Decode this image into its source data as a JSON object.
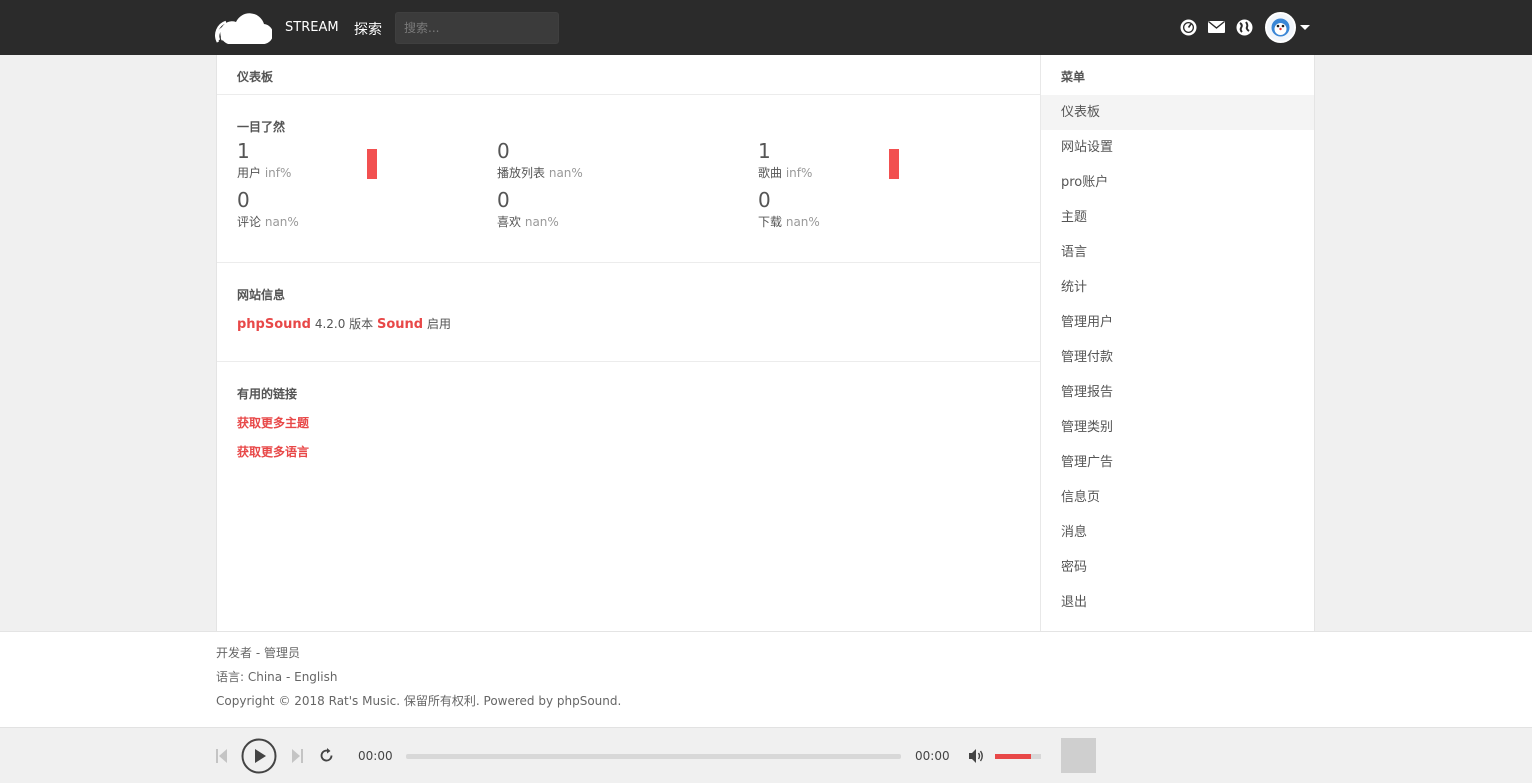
{
  "topbar": {
    "nav": {
      "stream": "STREAM",
      "explore": "探索"
    },
    "search_placeholder": "搜索..."
  },
  "main": {
    "header": "仪表板",
    "stats": {
      "title": "一目了然",
      "items": [
        {
          "value": "1",
          "label": "用户",
          "pct": "inf%"
        },
        {
          "value": "0",
          "label": "播放列表",
          "pct": "nan%"
        },
        {
          "value": "1",
          "label": "歌曲",
          "pct": "inf%"
        },
        {
          "value": "0",
          "label": "评论",
          "pct": "nan%"
        },
        {
          "value": "0",
          "label": "喜欢",
          "pct": "nan%"
        },
        {
          "value": "0",
          "label": "下载",
          "pct": "nan%"
        }
      ]
    },
    "info": {
      "title": "网站信息",
      "app": "phpSound",
      "version": "4.2.0 版本",
      "theme": "Sound",
      "status": "启用"
    },
    "links": {
      "title": "有用的链接",
      "items": [
        "获取更多主题",
        "获取更多语言"
      ]
    }
  },
  "sidebar": {
    "header": "菜单",
    "items": [
      "仪表板",
      "网站设置",
      "pro账户",
      "主题",
      "语言",
      "统计",
      "管理用户",
      "管理付款",
      "管理报告",
      "管理类别",
      "管理广告",
      "信息页",
      "消息",
      "密码",
      "退出"
    ]
  },
  "footer": {
    "line1_a": "开发者",
    "sep": " - ",
    "line1_b": "管理员",
    "line2_prefix": "语言: ",
    "lang_a": "China",
    "lang_b": "English",
    "copyright": "Copyright © 2018 Rat's Music. 保留所有权利. Powered by phpSound."
  },
  "player": {
    "time_current": "00:00",
    "time_total": "00:00",
    "volume_fraction": 0.78
  },
  "colors": {
    "accent": "#e84848",
    "topbar": "#2b2b2b"
  }
}
